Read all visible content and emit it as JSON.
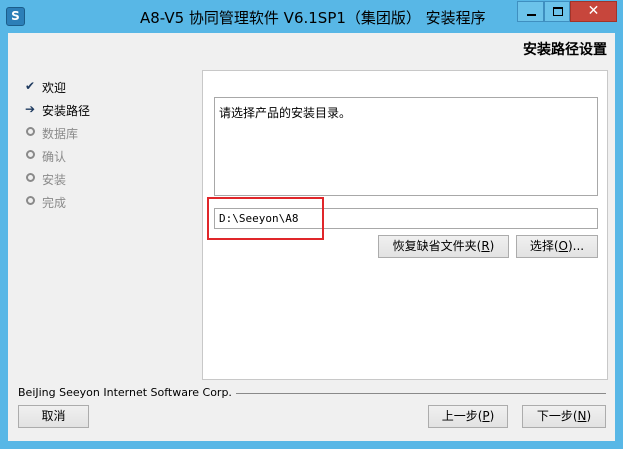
{
  "window": {
    "title": "A8-V5 协同管理软件 V6.1SP1（集团版） 安装程序",
    "icon": "app-logo-icon",
    "controls": {
      "minimize": "minimize-icon",
      "maximize": "maximize-icon",
      "close": "✕"
    }
  },
  "header": {
    "page_title": "安装路径设置"
  },
  "steps": [
    {
      "label": "欢迎",
      "state": "done",
      "mark": "✔"
    },
    {
      "label": "安装路径",
      "state": "current",
      "mark": "➔"
    },
    {
      "label": "数据库",
      "state": "todo"
    },
    {
      "label": "确认",
      "state": "todo"
    },
    {
      "label": "安装",
      "state": "todo"
    },
    {
      "label": "完成",
      "state": "todo"
    }
  ],
  "main": {
    "description": "请选择产品的安装目录。",
    "install_path": "D:\\Seeyon\\A8",
    "restore_button": {
      "label": "恢复缺省文件夹(",
      "accel": "R",
      "suffix": ")"
    },
    "choose_button": {
      "label": "选择(",
      "accel": "O",
      "suffix": ")..."
    }
  },
  "footer": {
    "company": "BeiJing Seeyon Internet Software Corp.",
    "cancel_label": "取消",
    "prev_button": {
      "label": "上一步(",
      "accel": "P",
      "suffix": ")"
    },
    "next_button": {
      "label": "下一步(",
      "accel": "N",
      "suffix": ")"
    }
  },
  "colors": {
    "title_bar": "#58b7e6",
    "close_button": "#c7463c",
    "highlight_border": "#e0262a"
  }
}
